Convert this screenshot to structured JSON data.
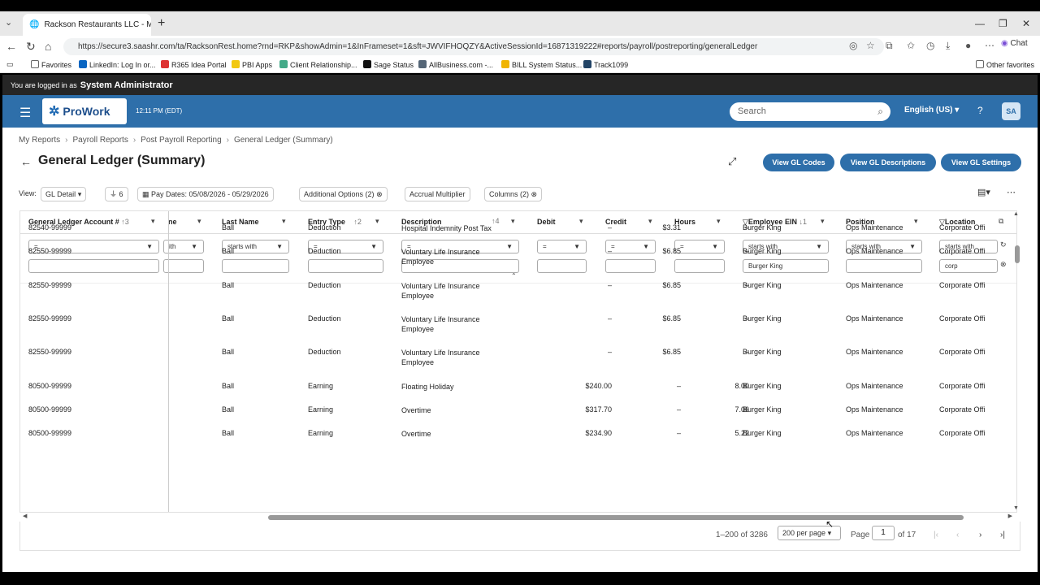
{
  "browser": {
    "tab_title": "Rackson Restaurants LLC - My Rep",
    "url": "https://secure3.saashr.com/ta/RacksonRest.home?rnd=RKP&showAdmin=1&InFrameset=1&sft=JWVIFHOQZY&ActiveSessionId=16871319222#reports/payroll/postreporting/generalLedger",
    "chat_label": "Chat",
    "bookmarks": [
      "Favorites",
      "LinkedIn: Log In or...",
      "R365 Idea Portal",
      "PBI Apps",
      "Client Relationship...",
      "Sage Status",
      "AllBusiness.com -...",
      "BILL System Status...",
      "Track1099"
    ],
    "other_favorites": "Other favorites"
  },
  "admin": {
    "prefix": "You are logged in as",
    "user": "System Administrator"
  },
  "header": {
    "brand": "ProWork",
    "time": "12:11 PM (EDT)",
    "search_placeholder": "Search",
    "language": "English (US)",
    "avatar": "SA"
  },
  "breadcrumb": [
    "My Reports",
    "Payroll Reports",
    "Post Payroll Reporting",
    "General Ledger (Summary)"
  ],
  "page": {
    "title": "General Ledger (Summary)",
    "buttons": [
      "View GL Codes",
      "View GL Descriptions",
      "View GL Settings"
    ]
  },
  "filters": {
    "view_label": "View:",
    "view_value": "GL Detail",
    "filter_count": "6",
    "pay_dates": "Pay Dates: 05/08/2026 - 05/29/2026",
    "additional": "Additional Options (2)",
    "accrual": "Accrual Multiplier",
    "columns": "Columns (2)"
  },
  "columns": {
    "account": "General Ledger Account #",
    "account_sort": "↑3",
    "first_name_partial": "ne",
    "last_name": "Last Name",
    "entry_type": "Entry Type",
    "entry_sort": "↑2",
    "description": "Description",
    "desc_sort": "↑4",
    "debit": "Debit",
    "credit": "Credit",
    "hours": "Hours",
    "ein": "Employee EIN",
    "ein_sort": "↓1",
    "position": "Position",
    "location": "Location"
  },
  "filter_row": {
    "account_op": "=",
    "first_op": "ith",
    "last_op": "starts with",
    "entry_op": "=",
    "desc_op": "=",
    "debit_op": "=",
    "credit_op": "=",
    "hours_op": "=",
    "ein_op": "starts with",
    "ein_value": "Burger King",
    "position_op": "starts with",
    "location_op": "starts with",
    "location_value": "corp"
  },
  "rows": [
    {
      "account": "82540-99999",
      "last": "Ball",
      "type": "Deduction",
      "desc1": "Hospital Indemnity Post Tax",
      "desc2": "",
      "debit": "–",
      "credit": "$3.31",
      "hours": "–",
      "ein": "Burger King",
      "position": "Ops Maintenance",
      "location": "Corporate Offi"
    },
    {
      "account": "82550-99999",
      "last": "Ball",
      "type": "Deduction",
      "desc1": "Voluntary Life Insurance",
      "desc2": "Employee",
      "debit": "–",
      "credit": "$6.85",
      "hours": "–",
      "ein": "Burger King",
      "position": "Ops Maintenance",
      "location": "Corporate Offi"
    },
    {
      "account": "82550-99999",
      "last": "Ball",
      "type": "Deduction",
      "desc1": "Voluntary Life Insurance",
      "desc2": "Employee",
      "debit": "–",
      "credit": "$6.85",
      "hours": "–",
      "ein": "Burger King",
      "position": "Ops Maintenance",
      "location": "Corporate Offi"
    },
    {
      "account": "82550-99999",
      "last": "Ball",
      "type": "Deduction",
      "desc1": "Voluntary Life Insurance",
      "desc2": "Employee",
      "debit": "–",
      "credit": "$6.85",
      "hours": "–",
      "ein": "Burger King",
      "position": "Ops Maintenance",
      "location": "Corporate Offi"
    },
    {
      "account": "82550-99999",
      "last": "Ball",
      "type": "Deduction",
      "desc1": "Voluntary Life Insurance",
      "desc2": "Employee",
      "debit": "–",
      "credit": "$6.85",
      "hours": "–",
      "ein": "Burger King",
      "position": "Ops Maintenance",
      "location": "Corporate Offi"
    },
    {
      "account": "80500-99999",
      "last": "Ball",
      "type": "Earning",
      "desc1": "Floating Holiday",
      "desc2": "",
      "debit": "$240.00",
      "credit": "–",
      "hours": "8.00",
      "ein": "Burger King",
      "position": "Ops Maintenance",
      "location": "Corporate Offi"
    },
    {
      "account": "80500-99999",
      "last": "Ball",
      "type": "Earning",
      "desc1": "Overtime",
      "desc2": "",
      "debit": "$317.70",
      "credit": "–",
      "hours": "7.06",
      "ein": "Burger King",
      "position": "Ops Maintenance",
      "location": "Corporate Offi"
    },
    {
      "account": "80500-99999",
      "last": "Ball",
      "type": "Earning",
      "desc1": "Overtime",
      "desc2": "",
      "debit": "$234.90",
      "credit": "–",
      "hours": "5.22",
      "ein": "Burger King",
      "position": "Ops Maintenance",
      "location": "Corporate Offi"
    }
  ],
  "pager": {
    "range": "1–200 of 3286",
    "per_page": "200 per page",
    "page_label": "Page",
    "page": "1",
    "of": "of 17"
  }
}
